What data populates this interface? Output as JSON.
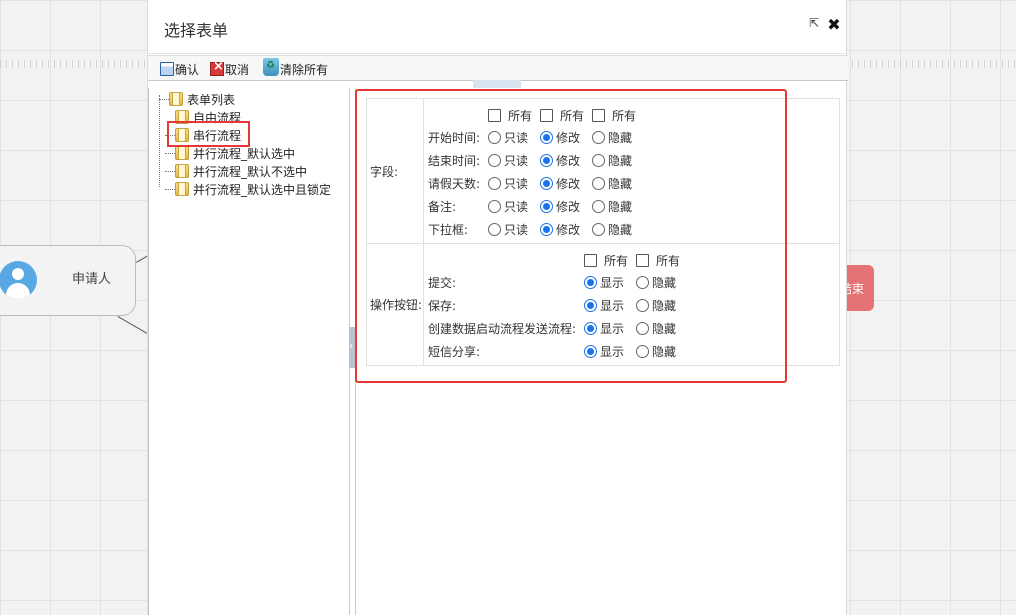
{
  "canvas": {
    "start_node_label": "申请人",
    "end_node_label": "结束"
  },
  "dialog": {
    "title": "选择表单",
    "popout_icon": "popout-icon",
    "close_icon": "close-icon"
  },
  "toolbar": {
    "confirm_label": "确认",
    "cancel_label": "取消",
    "clear_label": "清除所有"
  },
  "tree": {
    "root_label": "表单列表",
    "items": [
      {
        "label": "自由流程"
      },
      {
        "label": "串行流程",
        "selected": true
      },
      {
        "label": "并行流程_默认选中"
      },
      {
        "label": "并行流程_默认不选中"
      },
      {
        "label": "并行流程_默认选中且锁定"
      }
    ]
  },
  "fields_section": {
    "label": "字段:",
    "all_labels": [
      "所有",
      "所有",
      "所有"
    ],
    "option_labels": [
      "只读",
      "修改",
      "隐藏"
    ],
    "rows": [
      {
        "label": "开始时间:",
        "selected": "修改"
      },
      {
        "label": "结束时间:",
        "selected": "修改"
      },
      {
        "label": "请假天数:",
        "selected": "修改"
      },
      {
        "label": "备注:",
        "selected": "修改"
      },
      {
        "label": "下拉框:",
        "selected": "修改"
      }
    ]
  },
  "ops_section": {
    "label": "操作按钮:",
    "all_labels": [
      "所有",
      "所有"
    ],
    "option_labels": [
      "显示",
      "隐藏"
    ],
    "rows": [
      {
        "label": "提交:",
        "selected": "显示"
      },
      {
        "label": "保存:",
        "selected": "显示"
      },
      {
        "label": "创建数据启动流程发送流程:",
        "selected": "显示"
      },
      {
        "label": "短信分享:",
        "selected": "显示"
      }
    ]
  },
  "colors": {
    "highlight": "#e53935",
    "radio_selected": "#1a73e8",
    "end_node": "#e57373",
    "avatar": "#58a9e3"
  }
}
